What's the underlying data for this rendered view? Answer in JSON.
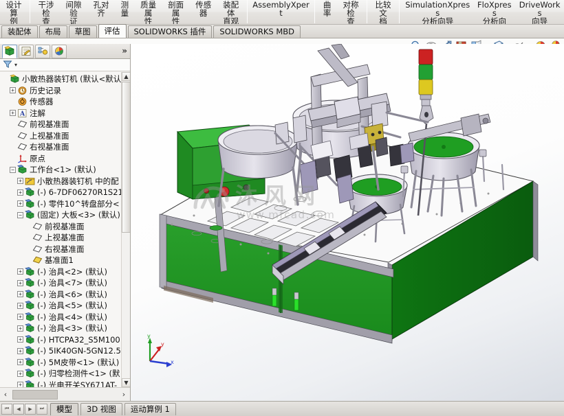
{
  "ribbon": {
    "items": [
      {
        "label": "设计算例",
        "lines": [
          "设计算",
          "例"
        ],
        "caret": true
      },
      {
        "sep": true
      },
      {
        "label": "干涉检查",
        "lines": [
          "干涉检",
          "查"
        ]
      },
      {
        "label": "间隙验证",
        "lines": [
          "间隙验",
          "证"
        ]
      },
      {
        "label": "孔对齐",
        "lines": [
          "孔对齐"
        ]
      },
      {
        "label": "测量",
        "lines": [
          "测量"
        ]
      },
      {
        "label": "质量属性",
        "lines": [
          "质量属",
          "性"
        ]
      },
      {
        "label": "剖面属性",
        "lines": [
          "剖面属",
          "性"
        ]
      },
      {
        "label": "传感器",
        "lines": [
          "传感器"
        ]
      },
      {
        "label": "装配体直观",
        "lines": [
          "装配体",
          "直观"
        ]
      },
      {
        "sep": true
      },
      {
        "label": "AssemblyXpert",
        "lines": [
          "AssemblyXpert"
        ]
      },
      {
        "sep": true
      },
      {
        "label": "曲率",
        "lines": [
          "曲率"
        ]
      },
      {
        "label": "对称检查",
        "lines": [
          "对称检",
          "查"
        ]
      },
      {
        "sep": true
      },
      {
        "label": "比较文档",
        "lines": [
          "比较文",
          "档"
        ]
      },
      {
        "sep": true
      },
      {
        "label": "SimulationXpress 分析向导",
        "lines": [
          "SimulationXpress",
          "分析向导"
        ]
      },
      {
        "label": "FloXpress 分析向导",
        "lines": [
          "FloXpress",
          "分析向",
          "导"
        ]
      },
      {
        "label": "DriveWorksXpress 向导",
        "lines": [
          "DriveWorks",
          "向导"
        ]
      }
    ]
  },
  "tabs": {
    "items": [
      {
        "label": "装配体",
        "active": false
      },
      {
        "label": "布局",
        "active": false
      },
      {
        "label": "草图",
        "active": false
      },
      {
        "label": "评估",
        "active": true
      },
      {
        "label": "SOLIDWORKS 插件",
        "active": false
      },
      {
        "label": "SOLIDWORKS MBD",
        "active": false
      }
    ]
  },
  "viewbar": {
    "icons": [
      {
        "name": "zoom-to-fit-icon",
        "caret": false
      },
      {
        "name": "rotate-view-icon",
        "caret": false
      },
      {
        "name": "section-view-icon",
        "caret": false
      },
      {
        "name": "measure-view-icon",
        "caret": false
      },
      {
        "name": "view-orientation-icon",
        "caret": true
      },
      {
        "name": "display-style-icon",
        "caret": true
      },
      {
        "name": "hide-show-items-icon",
        "caret": true
      },
      {
        "name": "appearances-icon",
        "caret": false
      },
      {
        "name": "scene-icon",
        "caret": false
      }
    ]
  },
  "feature_manager": {
    "tabs": [
      {
        "name": "feature-manager-tab",
        "selected": true
      },
      {
        "name": "property-manager-tab",
        "selected": false
      },
      {
        "name": "configuration-manager-tab",
        "selected": false
      },
      {
        "name": "display-manager-tab",
        "selected": false
      }
    ],
    "expand_label": "»",
    "filter_placeholder": "",
    "tree": [
      {
        "indent": 0,
        "toggle": "none",
        "icon": "assembly-icon",
        "label": "小散热器装钉机  (默认<默认_"
      },
      {
        "indent": 1,
        "toggle": "plus",
        "icon": "history-icon",
        "label": "历史记录"
      },
      {
        "indent": 1,
        "toggle": "none",
        "icon": "sensor-icon",
        "label": "传感器"
      },
      {
        "indent": 1,
        "toggle": "plus",
        "icon": "annotation-icon",
        "label": "注解"
      },
      {
        "indent": 1,
        "toggle": "none",
        "icon": "plane-icon",
        "label": "前视基准面"
      },
      {
        "indent": 1,
        "toggle": "none",
        "icon": "plane-icon",
        "label": "上视基准面"
      },
      {
        "indent": 1,
        "toggle": "none",
        "icon": "plane-icon",
        "label": "右视基准面"
      },
      {
        "indent": 1,
        "toggle": "none",
        "icon": "origin-icon",
        "label": "原点"
      },
      {
        "indent": 1,
        "toggle": "minus",
        "icon": "subassembly-icon",
        "label": "工作台<1> (默认)"
      },
      {
        "indent": 2,
        "toggle": "plus",
        "icon": "mate-folder-icon",
        "label": "小散热器装钉机 中的配"
      },
      {
        "indent": 2,
        "toggle": "plus",
        "icon": "part-icon",
        "label": "(-) 6-7DF06270R1S21"
      },
      {
        "indent": 2,
        "toggle": "plus",
        "icon": "part-icon",
        "label": "(-) 零件10^转盘部分<"
      },
      {
        "indent": 2,
        "toggle": "minus",
        "icon": "part-icon",
        "label": "(固定) 大板<3> (默认)"
      },
      {
        "indent": 3,
        "toggle": "none",
        "icon": "plane-icon",
        "label": "前视基准面"
      },
      {
        "indent": 3,
        "toggle": "none",
        "icon": "plane-icon",
        "label": "上视基准面"
      },
      {
        "indent": 3,
        "toggle": "none",
        "icon": "plane-icon",
        "label": "右视基准面"
      },
      {
        "indent": 3,
        "toggle": "none",
        "icon": "plane-gold-icon",
        "label": "基准面1"
      },
      {
        "indent": 2,
        "toggle": "plus",
        "icon": "part-icon",
        "label": "(-) 治具<2> (默认)"
      },
      {
        "indent": 2,
        "toggle": "plus",
        "icon": "part-icon",
        "label": "(-) 治具<7> (默认)"
      },
      {
        "indent": 2,
        "toggle": "plus",
        "icon": "part-icon",
        "label": "(-) 治具<6> (默认)"
      },
      {
        "indent": 2,
        "toggle": "plus",
        "icon": "part-icon",
        "label": "(-) 治具<5> (默认)"
      },
      {
        "indent": 2,
        "toggle": "plus",
        "icon": "part-icon",
        "label": "(-) 治具<4> (默认)"
      },
      {
        "indent": 2,
        "toggle": "plus",
        "icon": "part-icon",
        "label": "(-) 治具<3> (默认)"
      },
      {
        "indent": 2,
        "toggle": "plus",
        "icon": "part-icon",
        "label": "(-) HTCPA32_S5M100"
      },
      {
        "indent": 2,
        "toggle": "plus",
        "icon": "part-icon",
        "label": "(-) 5IK40GN-5GN12.5"
      },
      {
        "indent": 2,
        "toggle": "plus",
        "icon": "part-icon",
        "label": "(-) 5M皮带<1> (默认)"
      },
      {
        "indent": 2,
        "toggle": "plus",
        "icon": "part-icon",
        "label": "(-) 归零检测件<1> (默"
      },
      {
        "indent": 2,
        "toggle": "plus",
        "icon": "part-icon",
        "label": "(-) 光电开关SY671AT-"
      }
    ],
    "hscroll": {
      "left_arrow": "‹",
      "right_arrow": "›"
    },
    "vscroll": {
      "up_arrow": "⌃",
      "down_arrow": "⌄"
    }
  },
  "viewport": {
    "watermark_cn": "沐风网",
    "watermark_url": "www.mfcad.com",
    "triad": {
      "x_label": "x",
      "y_label": "y",
      "z_label": "z"
    },
    "colors": {
      "cabinet_green": "#1f8a22",
      "cabinet_green_dark": "#0f6b13",
      "panel_green_light": "#3aa83c",
      "steel": "#c8c6cf",
      "steel_dark": "#9a98a5",
      "plate_white": "#f4f4f6",
      "tower_red": "#cc2222",
      "tower_green": "#22aa33",
      "tower_yellow": "#e0cc22",
      "accent_purple": "#a9a2c0"
    }
  },
  "bottom": {
    "nav": [
      "⏮",
      "◀",
      "▶",
      "⏭"
    ],
    "tabs": [
      {
        "label": "模型",
        "active": true
      },
      {
        "label": "3D 视图",
        "active": false
      },
      {
        "label": "运动算例 1",
        "active": false
      }
    ]
  }
}
